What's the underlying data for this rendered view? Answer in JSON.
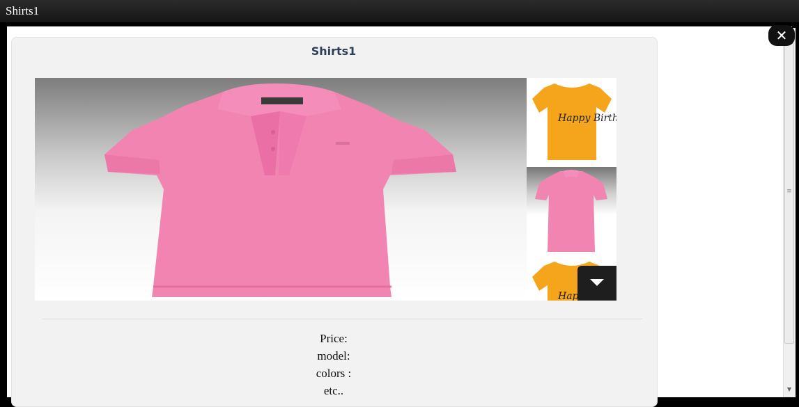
{
  "window": {
    "title": "Shirts1"
  },
  "dialog": {
    "close_symbol": "✕",
    "title": "Shirts1",
    "main_image_alt": "pink polo shirt",
    "thumbnails": [
      {
        "name": "yellow-birthday-tshirt",
        "text": "Happy Birthday",
        "color": "#f5a623"
      },
      {
        "name": "pink-polo-shirt",
        "color": "#f083b0"
      },
      {
        "name": "yellow-birthday-tshirt",
        "text": "Happy Birthday",
        "color": "#f5a623"
      }
    ],
    "info": {
      "price_label": "Price:",
      "model_label": "model:",
      "colors_label": "colors :",
      "etc_label": "etc.."
    }
  },
  "colors": {
    "shirt_pink": "#f284b2",
    "shirt_yellow": "#f5a51c",
    "title_text": "#2f3f56"
  }
}
